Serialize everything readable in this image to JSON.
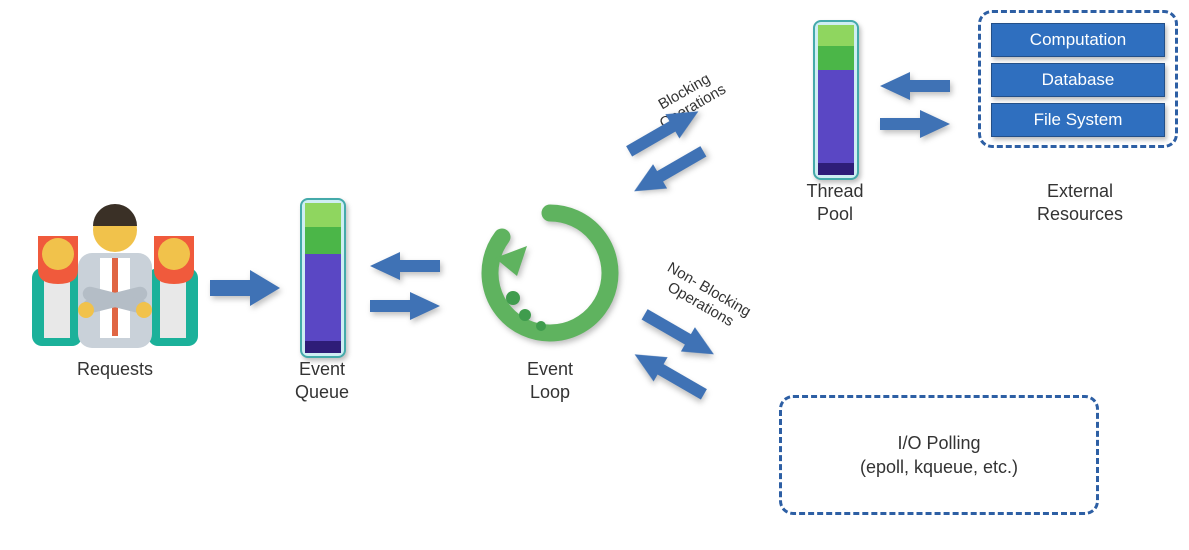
{
  "labels": {
    "requests": "Requests",
    "event_queue_1": "Event",
    "event_queue_2": "Queue",
    "event_loop_1": "Event",
    "event_loop_2": "Loop",
    "thread_pool_1": "Thread",
    "thread_pool_2": "Pool",
    "external_resources_1": "External",
    "external_resources_2": "Resources",
    "blocking_1": "Blocking",
    "blocking_2": "Operations",
    "nonblocking_1": "Non- Blocking",
    "nonblocking_2": "Operations",
    "io_polling_1": "I/O Polling",
    "io_polling_2": "(epoll, kqueue, etc.)"
  },
  "external_resources": {
    "items": [
      "Computation",
      "Database",
      "File System"
    ]
  },
  "colors": {
    "arrow": "#3f72b5",
    "loop": "#5fb35f",
    "dash": "#2d5fa4"
  }
}
